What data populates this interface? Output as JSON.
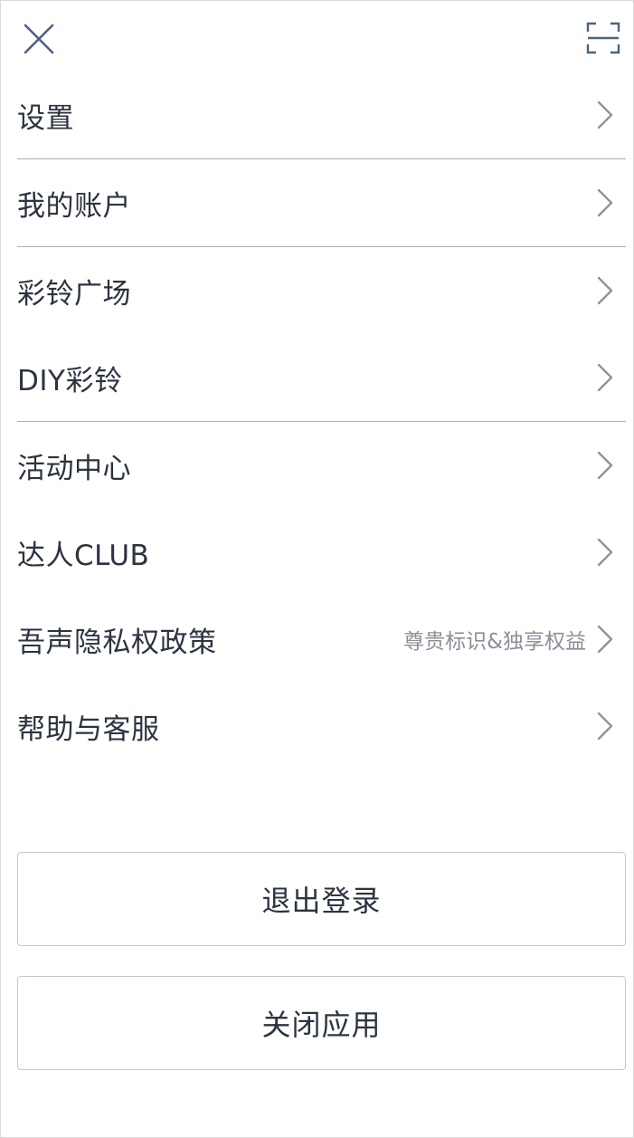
{
  "topbar": {
    "close_icon": "close-icon",
    "scan_icon": "scan-icon"
  },
  "menu": {
    "items": [
      {
        "label": "设置",
        "extra": ""
      },
      {
        "label": "我的账户",
        "extra": ""
      },
      {
        "label": "彩铃广场",
        "extra": ""
      },
      {
        "label": "DIY彩铃",
        "extra": ""
      },
      {
        "label": "活动中心",
        "extra": ""
      },
      {
        "label": "达人CLUB",
        "extra": ""
      },
      {
        "label": "吾声隐私权政策",
        "extra": "尊贵标识&独享权益"
      },
      {
        "label": "帮助与客服",
        "extra": ""
      }
    ],
    "chevron_icon": "chevron-right-icon"
  },
  "actions": {
    "logout_label": "退出登录",
    "exit_label": "关闭应用"
  },
  "colors": {
    "text": "#2b3440",
    "secondary_text": "#8a9099",
    "icon": "#4a6285",
    "chevron": "#8d949c",
    "divider": "#a9aeb3",
    "button_border": "#c4c8cc"
  }
}
